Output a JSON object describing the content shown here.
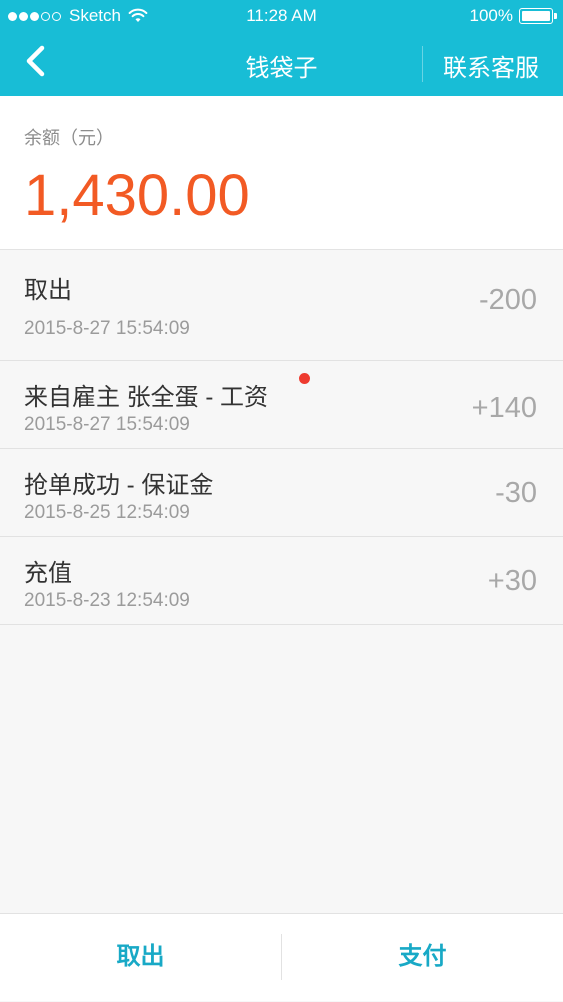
{
  "status_bar": {
    "carrier": "Sketch",
    "time": "11:28 AM",
    "battery": "100%"
  },
  "nav": {
    "title": "钱袋子",
    "service_label": "联系客服"
  },
  "balance": {
    "label": "余额（元）",
    "value": "1,430.00"
  },
  "transactions": [
    {
      "title": "取出",
      "date": "2015-8-27 15:54:09",
      "amount": "-200"
    },
    {
      "title": "来自雇主 张全蛋 - 工资",
      "date": "2015-8-27 15:54:09",
      "amount": "+140",
      "unread": true
    },
    {
      "title": "抢单成功 - 保证金",
      "date": "2015-8-25 12:54:09",
      "amount": "-30"
    },
    {
      "title": "充值",
      "date": "2015-8-23 12:54:09",
      "amount": "+30"
    }
  ],
  "bottom_bar": {
    "withdraw_label": "取出",
    "pay_label": "支付"
  },
  "colors": {
    "accent": "#18bdd6",
    "balance": "#f25a24",
    "unread_dot": "#ee3b2f"
  }
}
